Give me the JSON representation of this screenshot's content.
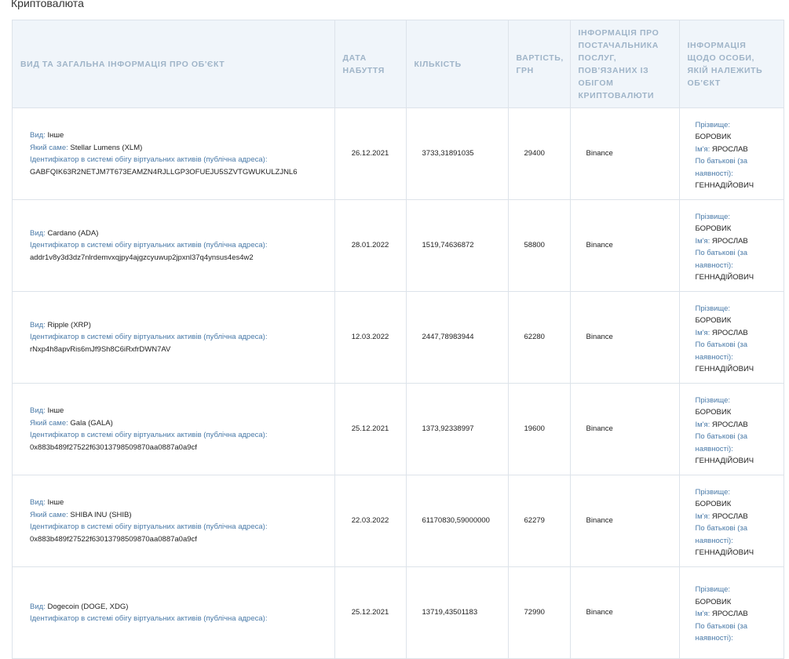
{
  "section_title": "Криптовалюта",
  "headers": {
    "object": "ВИД ТА ЗАГАЛЬНА ІНФОРМАЦІЯ ПРО ОБ'ЄКТ",
    "date": "ДАТА НАБУТТЯ",
    "quantity": "КІЛЬКІСТЬ",
    "value": "ВАРТІСТЬ, ГРН",
    "provider": "ІНФОРМАЦІЯ ПРО ПОСТАЧАЛЬНИКА ПОСЛУГ, ПОВ'ЯЗАНИХ ІЗ ОБІГОМ КРИПТОВАЛЮТИ",
    "owner": "ІНФОРМАЦІЯ ЩОДО ОСОБИ, ЯКІЙ НАЛЕЖИТЬ ОБ'ЄКТ"
  },
  "labels": {
    "type": "Вид:",
    "which": "Який саме:",
    "identifier": "Ідентифікатор в системі обігу віртуальних активів (публічна адреса):",
    "surname": "Прізвище:",
    "name": "Ім'я:",
    "patronymic_1": "По батькові (за",
    "patronymic_2": "наявності):"
  },
  "rows": [
    {
      "type": "Інше",
      "which": "Stellar Lumens (XLM)",
      "address": "GABFQIK63R2NETJM7T673EAMZN4RJLLGP3OFUEJU5SZVTGWUKULZJNL6",
      "date": "26.12.2021",
      "quantity": "3733,31891035",
      "value": "29400",
      "provider": "Binance",
      "surname": "БОРОВИК",
      "name": "ЯРОСЛАВ",
      "patronymic": "ГЕННАДІЙОВИЧ"
    },
    {
      "type": "Cardano (ADA)",
      "which": "",
      "address": "addr1v8y3d3dz7nlrdemvxqjpy4ajgzcyuwup2jpxnl37q4ynsus4es4w2",
      "date": "28.01.2022",
      "quantity": "1519,74636872",
      "value": "58800",
      "provider": "Binance",
      "surname": "БОРОВИК",
      "name": "ЯРОСЛАВ",
      "patronymic": "ГЕННАДІЙОВИЧ"
    },
    {
      "type": "Ripple (XRP)",
      "which": "",
      "address": "rNxp4h8apvRis6mJf9Sh8C6iRxfrDWN7AV",
      "date": "12.03.2022",
      "quantity": "2447,78983944",
      "value": "62280",
      "provider": "Binance",
      "surname": "БОРОВИК",
      "name": "ЯРОСЛАВ",
      "patronymic": "ГЕННАДІЙОВИЧ"
    },
    {
      "type": "Інше",
      "which": "Gala (GALA)",
      "address": "0x883b489f27522f63013798509870aa0887a0a9cf",
      "date": "25.12.2021",
      "quantity": "1373,92338997",
      "value": "19600",
      "provider": "Binance",
      "surname": "БОРОВИК",
      "name": "ЯРОСЛАВ",
      "patronymic": "ГЕННАДІЙОВИЧ"
    },
    {
      "type": "Інше",
      "which": "SHIBA INU (SHIB)",
      "address": "0x883b489f27522f63013798509870aa0887a0a9cf",
      "date": "22.03.2022",
      "quantity": "61170830,59000000",
      "value": "62279",
      "provider": "Binance",
      "surname": "БОРОВИК",
      "name": "ЯРОСЛАВ",
      "patronymic": "ГЕННАДІЙОВИЧ"
    },
    {
      "type": "Dogecoin (DOGE, XDG)",
      "which": "",
      "address": "",
      "date": "25.12.2021",
      "quantity": "13719,43501183",
      "value": "72990",
      "provider": "Binance",
      "surname": "БОРОВИК",
      "name": "ЯРОСЛАВ",
      "patronymic": ""
    }
  ]
}
